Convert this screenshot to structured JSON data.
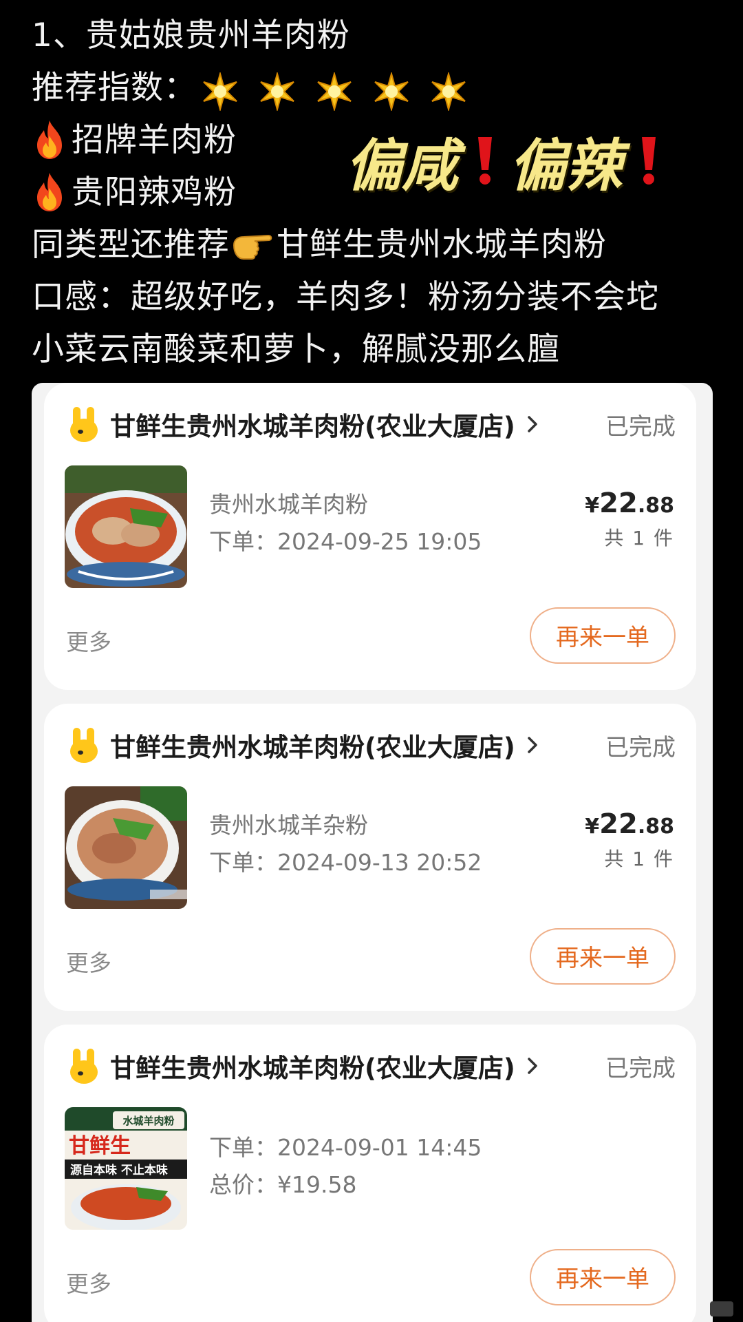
{
  "note": {
    "title": "1、贵姑娘贵州羊肉粉",
    "rating_label": "推荐指数：",
    "rating_stars": 5,
    "items": [
      {
        "icon": "fire-icon",
        "text": "招牌羊肉粉"
      },
      {
        "icon": "fire-icon",
        "text": "贵阳辣鸡粉"
      }
    ],
    "also_prefix": "同类型还推荐",
    "also_icon": "pointing-hand-icon",
    "also_name": "甘鲜生贵州水城羊肉粉",
    "taste": "口感：超级好吃，羊肉多！粉汤分装不会坨",
    "side": "小菜云南酸菜和萝卜，解腻没那么膻"
  },
  "overlay": {
    "word1": "偏咸",
    "word2": "偏辣",
    "color": "#f7e88a",
    "mark_color": "#e0141a"
  },
  "orders": [
    {
      "shop": "甘鲜生贵州水城羊肉粉(农业大厦店)",
      "status": "已完成",
      "item": "贵州水城羊肉粉",
      "time": "下单：2024-09-25 19:05",
      "yen": "¥",
      "price_int": "22",
      "price_dec": ".88",
      "qty": "共 1 件",
      "more": "更多",
      "reorder": "再来一单"
    },
    {
      "shop": "甘鲜生贵州水城羊肉粉(农业大厦店)",
      "status": "已完成",
      "item": "贵州水城羊杂粉",
      "time": "下单：2024-09-13 20:52",
      "yen": "¥",
      "price_int": "22",
      "price_dec": ".88",
      "qty": "共 1 件",
      "more": "更多",
      "reorder": "再来一单"
    },
    {
      "shop": "甘鲜生贵州水城羊肉粉(农业大厦店)",
      "status": "已完成",
      "time": "下单：2024-09-01 14:45",
      "total": "总价：¥19.58",
      "more": "更多",
      "reorder": "再来一单",
      "poster_brand": "甘鲜生",
      "poster_tag": "水城羊肉粉",
      "poster_slogan": "源自本味 不止本味"
    }
  ],
  "colors": {
    "accent": "#e4691f",
    "status_gray": "#777777",
    "background": "#000000"
  }
}
